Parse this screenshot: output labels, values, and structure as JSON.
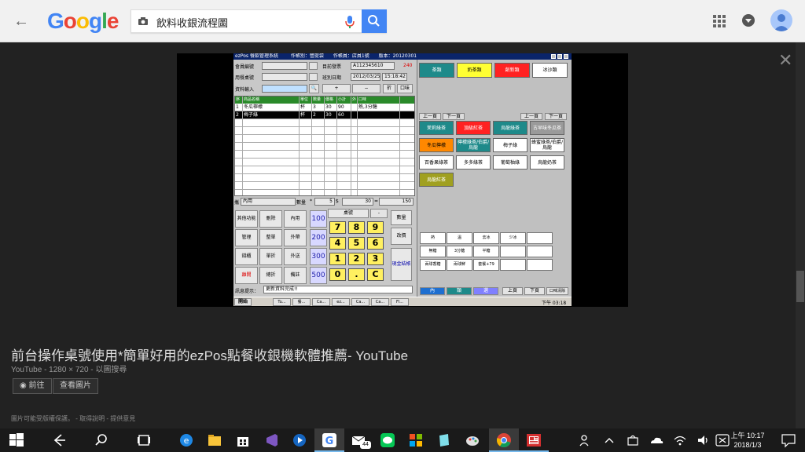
{
  "browser": {
    "logo_letters": [
      {
        "ch": "G",
        "color": "#4285f4"
      },
      {
        "ch": "o",
        "color": "#ea4335"
      },
      {
        "ch": "o",
        "color": "#fbbc05"
      },
      {
        "ch": "g",
        "color": "#4285f4"
      },
      {
        "ch": "l",
        "color": "#34a853"
      },
      {
        "ch": "e",
        "color": "#ea4335"
      }
    ],
    "search_query": "飲料收銀流程圖"
  },
  "viewer": {
    "title": "前台操作桌號使用*簡單好用的ezPos點餐收銀機軟體推薦- YouTube",
    "meta": "YouTube - 1280 × 720 - 以圖搜尋",
    "visit_label": "前往",
    "view_image_label": "查看圖片",
    "notice": "圖片可能受版權保護。 - 取得說明 - 提供意見"
  },
  "pos": {
    "title": "ezPos 餐飲管理系統",
    "operator": "作帳別：營提袋",
    "clerk": "作帳員：店員1號",
    "version": "版本：20120301",
    "member_label": "會員編號",
    "invoice_label": "目前發票",
    "invoice_value": "A112345610",
    "invoice_count": "240",
    "meal_label": "用餐桌號",
    "shift_label": "班別日期",
    "date_value": "2012/03/25",
    "time_value": "15:18:42",
    "input_label": "資料輸入",
    "plus": "+",
    "minus": "−",
    "discount": "折",
    "taste": "口味",
    "grid_headers": [
      "序",
      "商品名稱",
      "單位",
      "數量",
      "價格",
      "小計",
      "外",
      "口味"
    ],
    "rows": [
      [
        "1",
        "冬瓜檸檬",
        "杯",
        "3",
        "30",
        "90",
        "",
        "熱,3分糖"
      ],
      [
        "2",
        "梅子綠",
        "杯",
        "2",
        "30",
        "60",
        "",
        ""
      ]
    ],
    "dine_label": "內用",
    "qty_label": "數量",
    "qty_value": "5",
    "dollar": "$",
    "price_value": "30",
    "eq": "=",
    "total_value": "150",
    "func_keys": [
      "其他功能",
      "刪除",
      "內用",
      "管理",
      "整單",
      "外帶",
      "錢櫃",
      "單折",
      "外送",
      "離開",
      "總折",
      "備註"
    ],
    "amounts": [
      "100",
      "200",
      "300",
      "500"
    ],
    "table_no": "桌號",
    "dash": "-",
    "qty_btn": "數量",
    "change_price": "改價",
    "cash_checkout": "現金結帳",
    "numpad": [
      "7",
      "8",
      "9",
      "4",
      "5",
      "6",
      "1",
      "2",
      "3",
      "0",
      ".",
      "C"
    ],
    "message_label": "訊息提示：",
    "message": "更新資料完成!!",
    "categories": [
      {
        "label": "茶類",
        "bg": "#1e8a8a",
        "fg": "#fff"
      },
      {
        "label": "奶茶類",
        "bg": "#ffff33",
        "fg": "#000"
      },
      {
        "label": "創新類",
        "bg": "#ff2222",
        "fg": "#fff"
      },
      {
        "label": "冰沙類",
        "bg": "#ffffff",
        "fg": "#000"
      }
    ],
    "page_prev": "上一頁",
    "page_next": "下一頁",
    "drinks": [
      {
        "label": "茉莉綠茶",
        "bg": "#1e8a8a",
        "fg": "#fff"
      },
      {
        "label": "頂級紅茶",
        "bg": "#ff2222",
        "fg": "#fff"
      },
      {
        "label": "烏龍綠茶",
        "bg": "#1e8a8a",
        "fg": "#fff"
      },
      {
        "label": "古早味冬瓜茶",
        "bg": "#9a9a9a",
        "fg": "#fff"
      },
      {
        "label": "冬瓜檸檬",
        "bg": "#ff8800",
        "fg": "#000"
      },
      {
        "label": "檸檬綠茶/伯爵/烏龍",
        "bg": "#1e8a8a",
        "fg": "#fff"
      },
      {
        "label": "梅子綠",
        "bg": "#ffffff",
        "fg": "#000"
      },
      {
        "label": "蜂蜜綠茶/伯爵/烏龍",
        "bg": "#ffffff",
        "fg": "#000"
      },
      {
        "label": "百香果綠茶",
        "bg": "#ffffff",
        "fg": "#000"
      },
      {
        "label": "多多綠茶",
        "bg": "#ffffff",
        "fg": "#000"
      },
      {
        "label": "葡萄柚綠",
        "bg": "#ffffff",
        "fg": "#000"
      },
      {
        "label": "烏龍奶茶",
        "bg": "#ffffff",
        "fg": "#000"
      },
      {
        "label": "烏龍紅茶",
        "bg": "#a0a020",
        "fg": "#fff"
      }
    ],
    "options": [
      "熱",
      "溫",
      "去冰",
      "少冰",
      "",
      "無糖",
      "3分糖",
      "半糖",
      "",
      "",
      "兩球香糖",
      "兩球鮮",
      "套餐+79",
      "",
      ""
    ],
    "bottom_tabs": [
      "內",
      "類",
      "選"
    ],
    "opt_prev": "上頁",
    "opt_next": "下頁",
    "opt_clear": "口味清除",
    "start_label": "開始",
    "task_items": [
      "Tu...",
      "餐...",
      "Ca...",
      "ez...",
      "Ca...",
      "Ca...",
      "Fl..."
    ],
    "tray_time": "下午 03:18"
  },
  "taskbar": {
    "time": "上午 10:17",
    "date": "2018/1/3",
    "mail_badge": "44"
  }
}
